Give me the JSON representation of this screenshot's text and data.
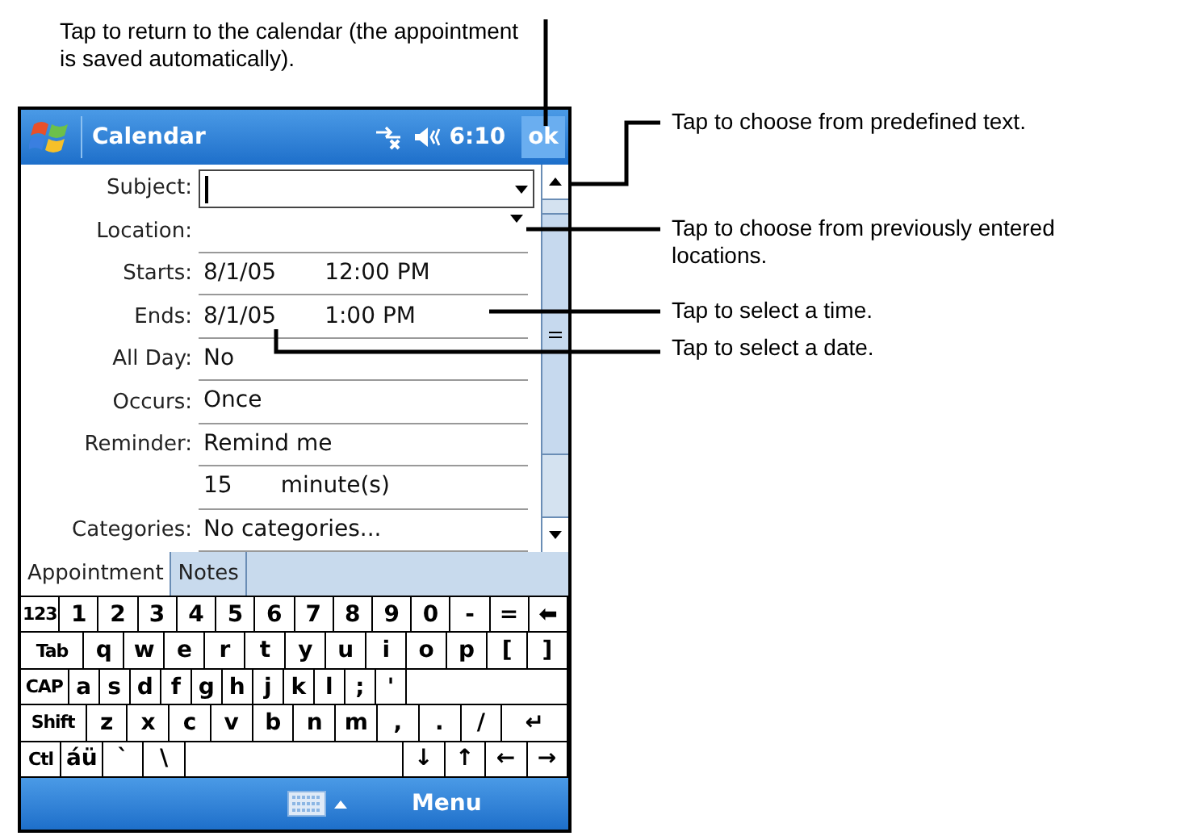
{
  "callouts": [
    {
      "text": "Tap to return to the calendar (the appointment is saved automatically)."
    },
    {
      "text": "Tap to choose from predefined text."
    },
    {
      "text": "Tap to choose from previously entered locations."
    },
    {
      "text": "Tap to select a time."
    },
    {
      "text": "Tap to select a date."
    }
  ],
  "title_bar": {
    "title": "Calendar",
    "time": "6:10",
    "ok": "ok"
  },
  "form": [
    {
      "label": "Subject:",
      "kind": "combo"
    },
    {
      "label": "Location:",
      "kind": "dropdown"
    },
    {
      "label": "Starts:",
      "kind": "text",
      "values": [
        "8/1/05",
        "12:00 PM"
      ]
    },
    {
      "label": "Ends:",
      "kind": "text",
      "values": [
        "8/1/05",
        "1:00 PM"
      ]
    },
    {
      "label": "All Day:",
      "kind": "text",
      "values": [
        "No"
      ]
    },
    {
      "label": "Occurs:",
      "kind": "text",
      "values": [
        "Once"
      ]
    },
    {
      "label": "Reminder:",
      "kind": "text",
      "values": [
        "Remind me"
      ]
    },
    {
      "kind": "text",
      "values": [
        "15",
        "minute(s)"
      ]
    },
    {
      "label": "Categories:",
      "kind": "text",
      "values": [
        "No categories..."
      ]
    }
  ],
  "tabs": [
    {
      "label": "Appointment",
      "selected": true
    },
    {
      "label": "Notes",
      "selected": false
    }
  ],
  "keyboard": [
    [
      {
        "label": "123",
        "kind": "key"
      },
      {
        "label": "1",
        "kind": "key"
      },
      {
        "label": "2",
        "kind": "key"
      },
      {
        "label": "3",
        "kind": "key"
      },
      {
        "label": "4",
        "kind": "key"
      },
      {
        "label": "5",
        "kind": "key"
      },
      {
        "label": "6",
        "kind": "key"
      },
      {
        "label": "7",
        "kind": "key"
      },
      {
        "label": "8",
        "kind": "key"
      },
      {
        "label": "9",
        "kind": "key"
      },
      {
        "label": "0",
        "kind": "key"
      },
      {
        "label": "-",
        "kind": "key"
      },
      {
        "label": "=",
        "kind": "key"
      },
      {
        "label": "⬅",
        "kind": "key"
      }
    ],
    [
      {
        "label": "Tab",
        "kind": "wide"
      },
      {
        "label": "q",
        "kind": "key"
      },
      {
        "label": "w",
        "kind": "key"
      },
      {
        "label": "e",
        "kind": "key"
      },
      {
        "label": "r",
        "kind": "key"
      },
      {
        "label": "t",
        "kind": "key"
      },
      {
        "label": "y",
        "kind": "key"
      },
      {
        "label": "u",
        "kind": "key"
      },
      {
        "label": "i",
        "kind": "key"
      },
      {
        "label": "o",
        "kind": "key"
      },
      {
        "label": "p",
        "kind": "key"
      },
      {
        "label": "[",
        "kind": "key"
      },
      {
        "label": "]",
        "kind": "key"
      }
    ],
    [
      {
        "label": "CAP",
        "kind": "wide"
      },
      {
        "label": "a",
        "kind": "key"
      },
      {
        "label": "s",
        "kind": "key"
      },
      {
        "label": "d",
        "kind": "key"
      },
      {
        "label": "f",
        "kind": "key"
      },
      {
        "label": "g",
        "kind": "key"
      },
      {
        "label": "h",
        "kind": "key"
      },
      {
        "label": "j",
        "kind": "key"
      },
      {
        "label": "k",
        "kind": "key"
      },
      {
        "label": "l",
        "kind": "key"
      },
      {
        "label": ";",
        "kind": "key"
      },
      {
        "label": "'",
        "kind": "key"
      },
      {
        "kind": "space"
      }
    ],
    [
      {
        "label": "Shift",
        "kind": "wide"
      },
      {
        "label": "z",
        "kind": "key"
      },
      {
        "label": "x",
        "kind": "key"
      },
      {
        "label": "c",
        "kind": "key"
      },
      {
        "label": "v",
        "kind": "key"
      },
      {
        "label": "b",
        "kind": "key"
      },
      {
        "label": "n",
        "kind": "key"
      },
      {
        "label": "m",
        "kind": "key"
      },
      {
        "label": ",",
        "kind": "key"
      },
      {
        "label": ".",
        "kind": "key"
      },
      {
        "label": "/",
        "kind": "key"
      },
      {
        "label": "↵",
        "kind": "wide"
      }
    ],
    [
      {
        "label": "Ctl",
        "kind": "key"
      },
      {
        "label": "áü",
        "kind": "key"
      },
      {
        "label": "`",
        "kind": "key"
      },
      {
        "label": "\\",
        "kind": "key"
      },
      {
        "kind": "space"
      },
      {
        "label": "↓",
        "kind": "key"
      },
      {
        "label": "↑",
        "kind": "key"
      },
      {
        "label": "←",
        "kind": "key"
      },
      {
        "label": "→",
        "kind": "key"
      }
    ]
  ],
  "menu_bar": {
    "menu": "Menu"
  }
}
